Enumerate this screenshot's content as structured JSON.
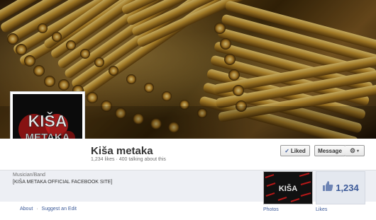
{
  "page": {
    "name": "Kiša metaka",
    "likes_text": "1,234 likes",
    "talking_text": "400 talking about this",
    "stats_separator": "·"
  },
  "profile_logo": {
    "line1": "KIŠA",
    "line2": "METAKA"
  },
  "buttons": {
    "liked_check": "✓",
    "liked_label": "Liked",
    "message_label": "Message",
    "gear_icon": "⚙",
    "caret_icon": "▾"
  },
  "about": {
    "category": "Musician/Band",
    "description": "[KIŠA METAKA OFFICIAL FACEBOOK SITE]"
  },
  "sections": {
    "photos_label": "Photos",
    "likes_label": "Likes",
    "likes_count": "1,234",
    "thumb_logo": "KIŠA"
  },
  "footer": {
    "about_link": "About",
    "separator": "·",
    "suggest_link": "Suggest an Edit"
  },
  "colors": {
    "link": "#3b5998",
    "strip": "#edeff4",
    "logo_red": "#c41e1e"
  },
  "icons": {
    "thumbs_up": "thumbs-up-icon",
    "gear": "gear-icon",
    "check": "check-icon"
  }
}
